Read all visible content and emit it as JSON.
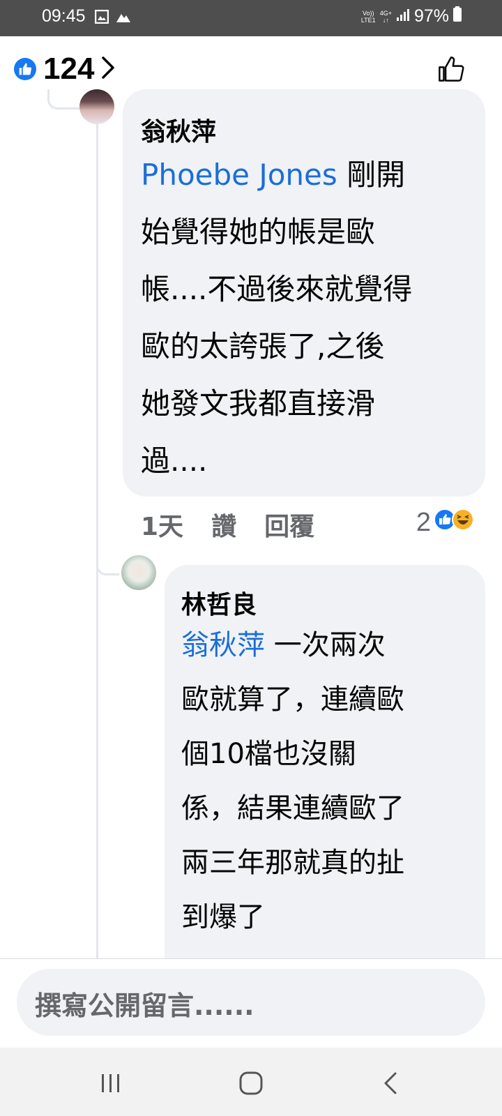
{
  "status_bar": {
    "time": "09:45",
    "network_top": "Vo))",
    "network_bottom": "LTE1",
    "network_type": "4G+",
    "battery": "97%"
  },
  "header": {
    "like_count": "124",
    "accent_color": "#1877f2"
  },
  "comments": [
    {
      "author": "翁秋萍",
      "mention": "Phoebe Jones",
      "lines": [
        "剛開",
        "始覺得她的帳是歐",
        "帳....不過後來就覺得",
        "歐的太誇張了,之後",
        "她發文我都直接滑",
        "過...."
      ],
      "time": "1天",
      "like_label": "讚",
      "reply_label": "回覆",
      "reaction_count": "2"
    },
    {
      "author": "林哲良",
      "mention": "翁秋萍",
      "lines": [
        "一次兩次",
        "歐就算了，連續歐",
        "個10檔也沒關",
        "係，結果連續歐了",
        "兩三年那就真的扯",
        "到爆了"
      ]
    }
  ],
  "composer": {
    "placeholder": "撰寫公開留言......"
  },
  "icons": [
    "like-badge-icon",
    "chevron-right-icon",
    "thumbs-up-icon",
    "haha-icon",
    "recent-apps-icon",
    "home-icon",
    "back-icon"
  ]
}
